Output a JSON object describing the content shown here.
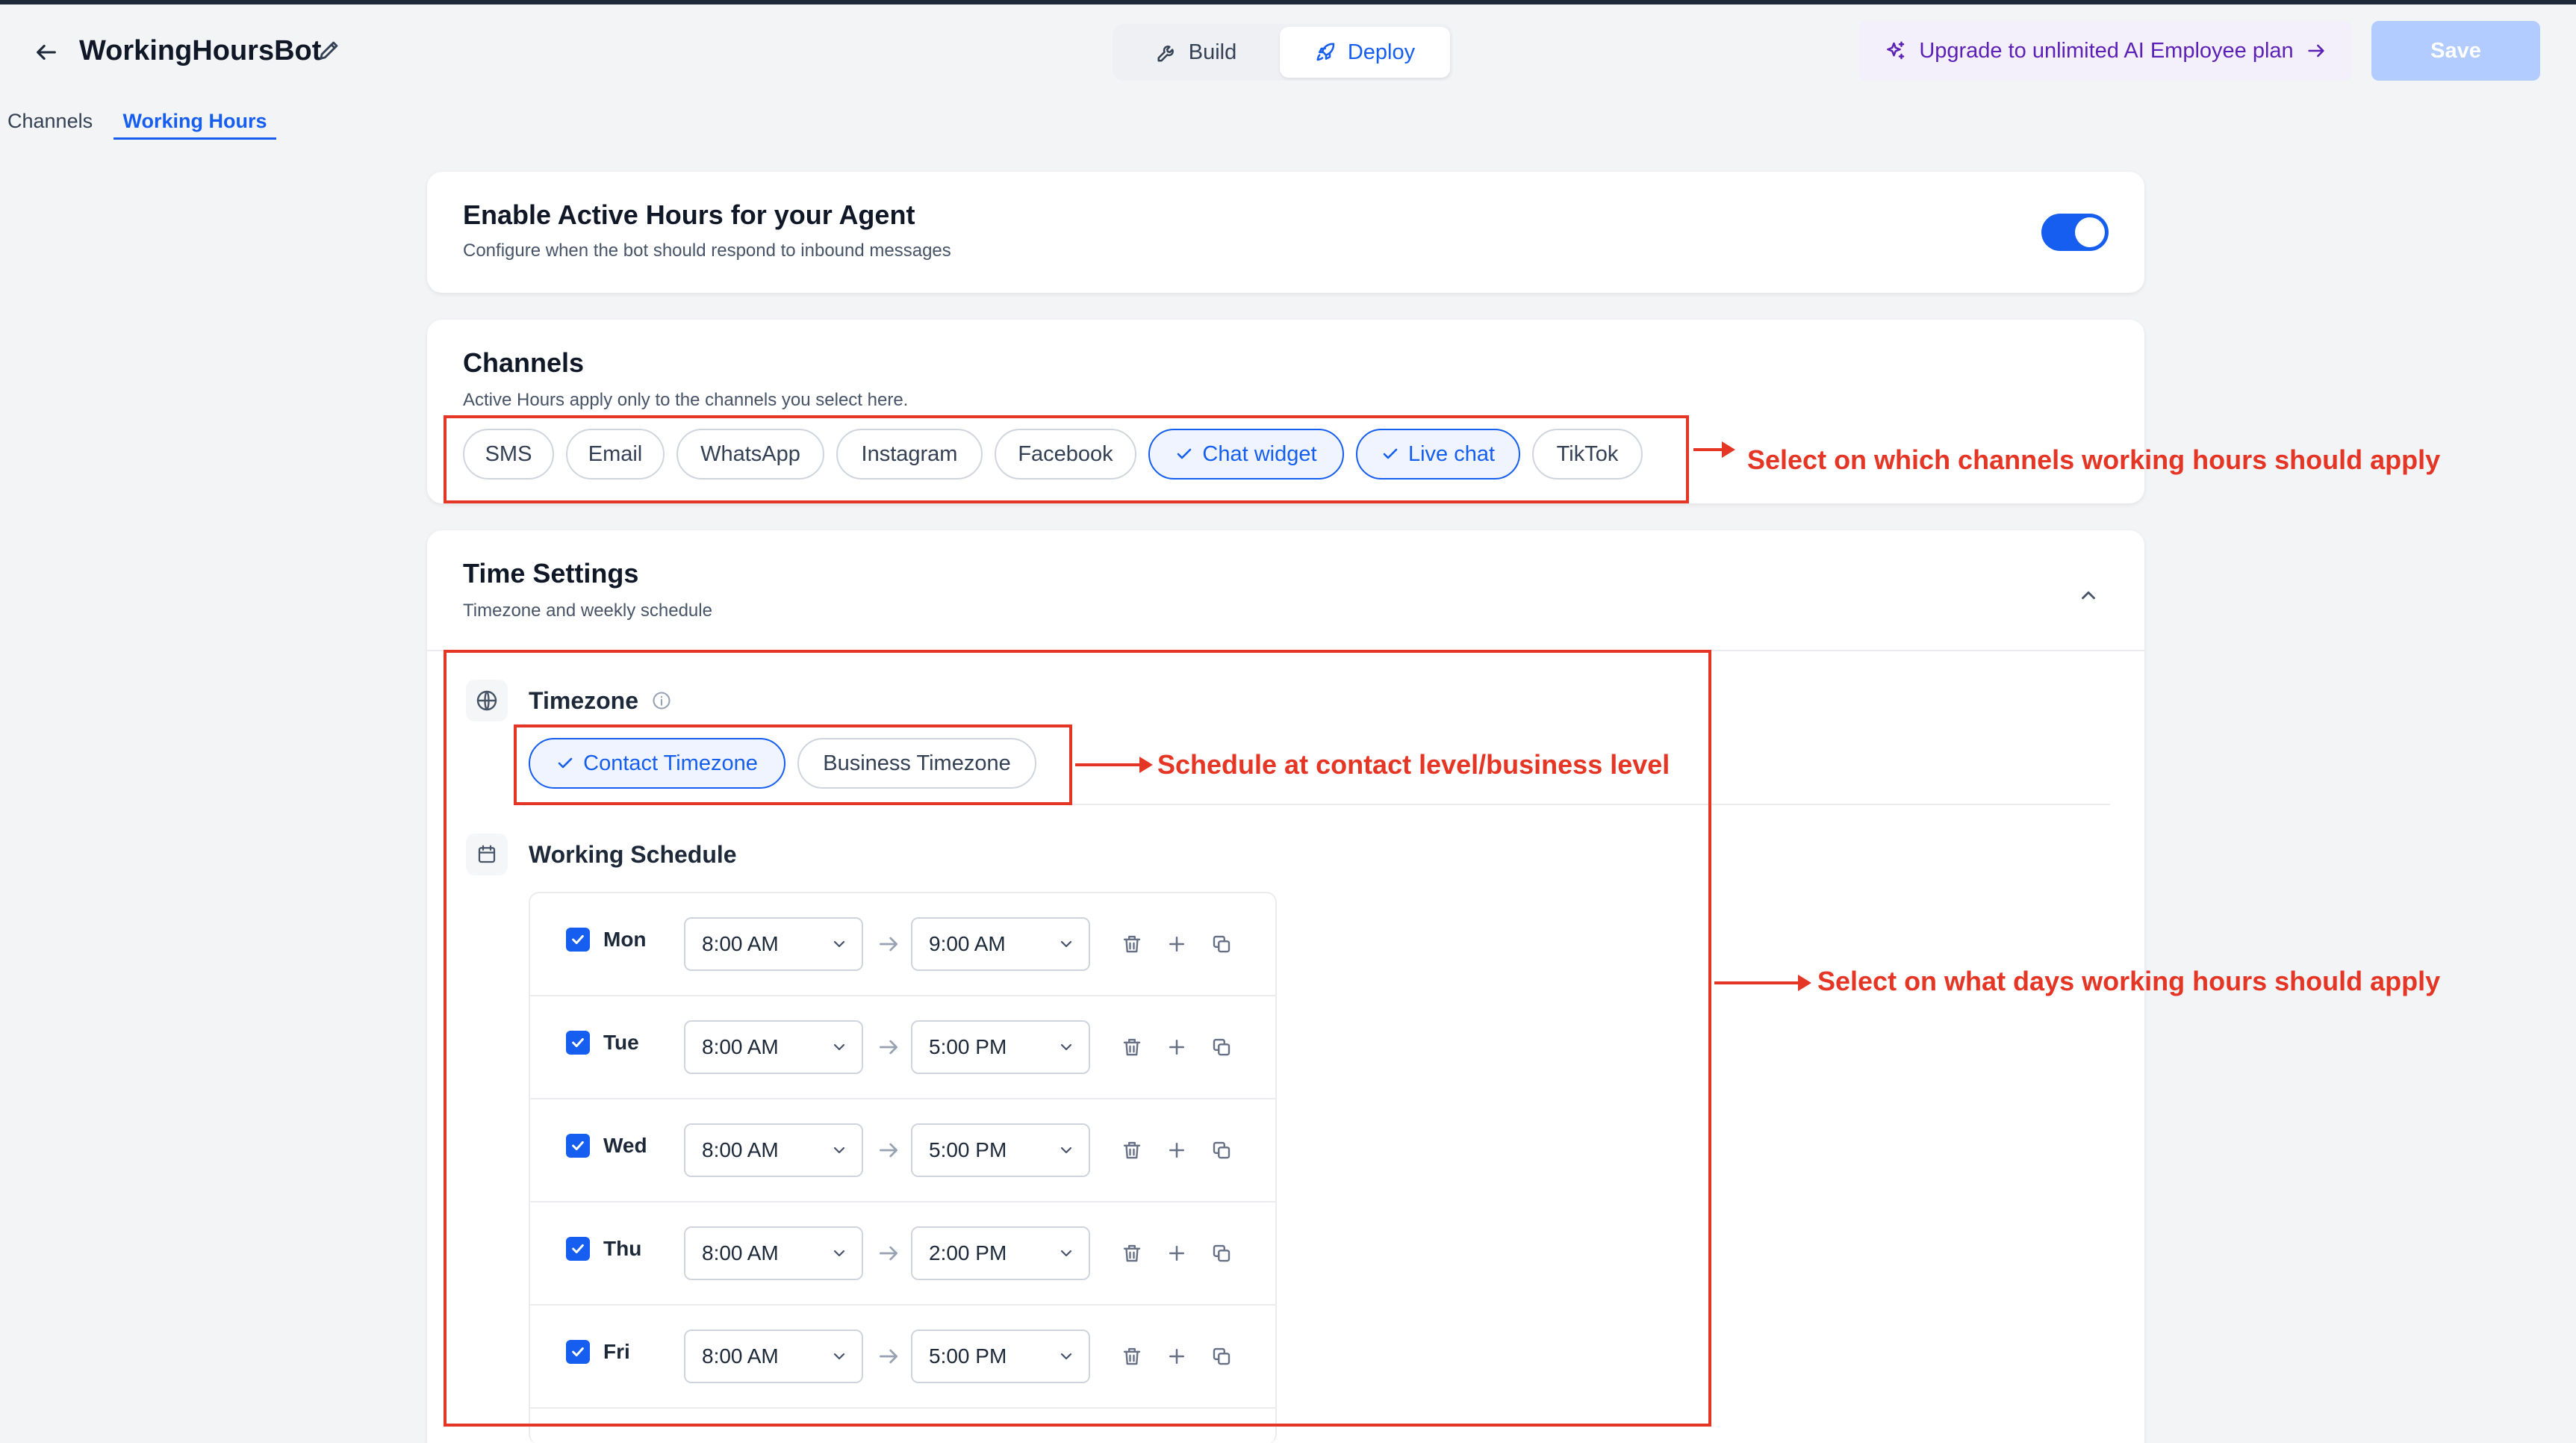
{
  "header": {
    "title": "WorkingHoursBot",
    "build_label": "Build",
    "deploy_label": "Deploy",
    "upgrade_label": "Upgrade to unlimited AI Employee plan",
    "save_label": "Save"
  },
  "tabs": [
    {
      "label": "Channels",
      "active": false
    },
    {
      "label": "Working Hours",
      "active": true
    }
  ],
  "active_hours": {
    "title": "Enable Active Hours for your Agent",
    "subtitle": "Configure when the bot should respond to inbound messages",
    "enabled": true
  },
  "channels": {
    "title": "Channels",
    "subtitle": "Active Hours apply only to the channels you select here.",
    "items": [
      {
        "label": "SMS",
        "selected": false
      },
      {
        "label": "Email",
        "selected": false
      },
      {
        "label": "WhatsApp",
        "selected": false
      },
      {
        "label": "Instagram",
        "selected": false
      },
      {
        "label": "Facebook",
        "selected": false
      },
      {
        "label": "Chat widget",
        "selected": true
      },
      {
        "label": "Live chat",
        "selected": true
      },
      {
        "label": "TikTok",
        "selected": false
      }
    ]
  },
  "time_settings": {
    "title": "Time Settings",
    "subtitle": "Timezone and weekly schedule",
    "timezone": {
      "title": "Timezone",
      "options": [
        {
          "label": "Contact Timezone",
          "selected": true
        },
        {
          "label": "Business Timezone",
          "selected": false
        }
      ]
    },
    "schedule": {
      "title": "Working Schedule",
      "days": [
        {
          "day": "Mon",
          "checked": true,
          "start": "8:00 AM",
          "end": "9:00 AM"
        },
        {
          "day": "Tue",
          "checked": true,
          "start": "8:00 AM",
          "end": "5:00 PM"
        },
        {
          "day": "Wed",
          "checked": true,
          "start": "8:00 AM",
          "end": "5:00 PM"
        },
        {
          "day": "Thu",
          "checked": true,
          "start": "8:00 AM",
          "end": "2:00 PM"
        },
        {
          "day": "Fri",
          "checked": true,
          "start": "8:00 AM",
          "end": "5:00 PM"
        }
      ]
    }
  },
  "annotations": {
    "channels": "Select on which channels working hours should apply",
    "timezone": "Schedule at contact level/business level",
    "days": "Select on what days working hours should apply"
  },
  "colors": {
    "accent": "#155eef",
    "annotation": "#e53525",
    "upgrade_text": "#5b21b6",
    "save_disabled": "#b2ccff"
  }
}
